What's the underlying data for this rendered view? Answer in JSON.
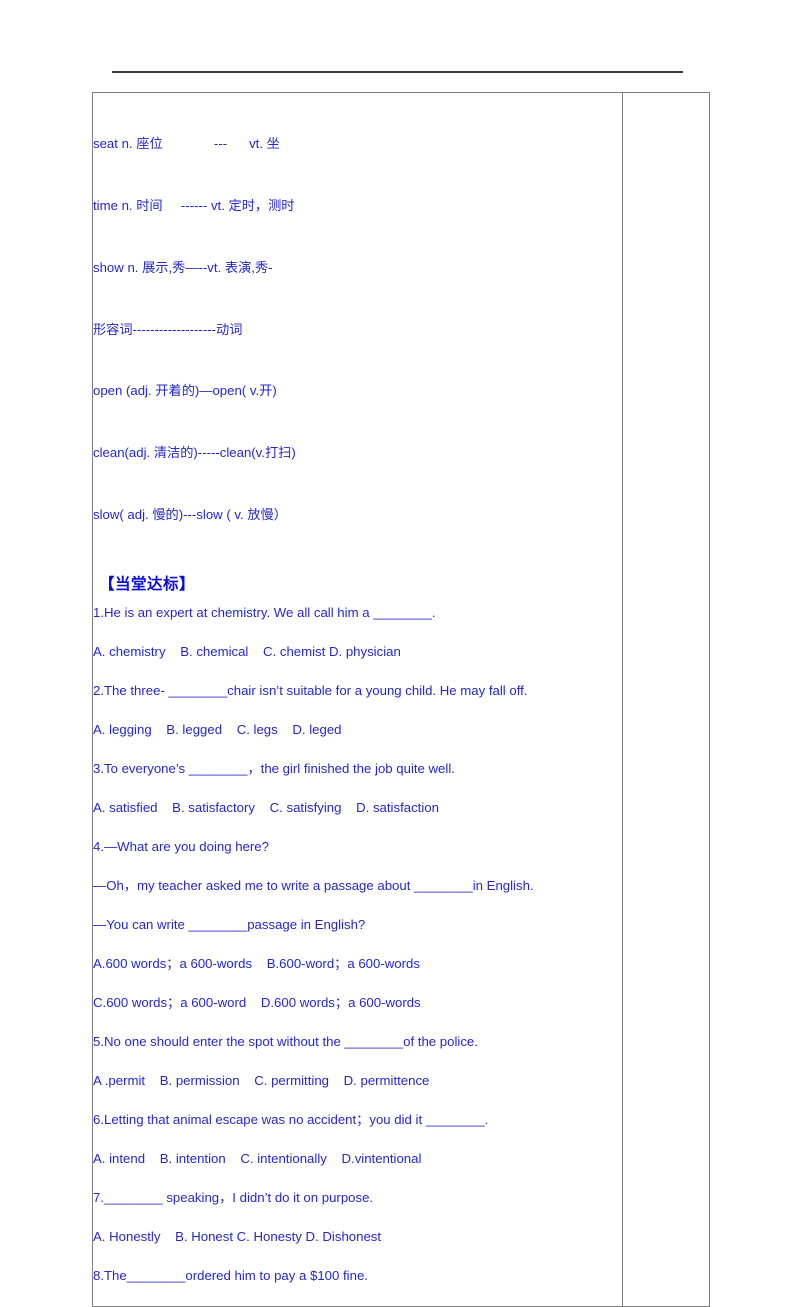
{
  "document": {
    "text_color": "#2727c8",
    "heading_color": "#0b0bd2",
    "border_color": "#808080",
    "rule_color": "#3a3a3a"
  },
  "vocabulary": {
    "lines": [
      "seat n. 座位              ---      vt. 坐",
      "time n. 时间     ------ vt. 定时，测时",
      "show n. 展示,秀—--vt. 表演,秀-",
      "形容词-------------------动词",
      "open (adj. 开着的)—open( v.开)",
      "clean(adj. 清洁的)-----clean(v.打扫)",
      "slow( adj. 慢的)---slow ( v. 放慢）"
    ]
  },
  "section": {
    "heading": "【当堂达标】"
  },
  "exercises": [
    {
      "id": "q1-stem",
      "text": "1.He is an expert at chemistry. We all call him a ________."
    },
    {
      "id": "q1-options",
      "text": "A. chemistry    B. chemical    C. chemist D. physician"
    },
    {
      "id": "q2-stem",
      "text": "2.The three- ________chair isn’t suitable for a young child. He may fall off."
    },
    {
      "id": "q2-options",
      "text": "A. legging    B. legged    C. legs    D. leged"
    },
    {
      "id": "q3-stem",
      "text": "3.To everyone’s ________，the girl finished the job quite well."
    },
    {
      "id": "q3-options",
      "text": "A. satisfied    B. satisfactory    C. satisfying    D. satisfaction"
    },
    {
      "id": "q4-stem",
      "text": "4.—What are you doing here?"
    },
    {
      "id": "q4-line2",
      "text": "—Oh，my teacher asked me to write a passage about ________in English."
    },
    {
      "id": "q4-line3",
      "text": "—You can write ________passage in English?"
    },
    {
      "id": "q4-options1",
      "text": "A.600 words；a 600-words    B.600-word；a 600-words"
    },
    {
      "id": "q4-options2",
      "text": "C.600 words；a 600-word    D.600 words；a 600-words"
    },
    {
      "id": "q5-stem",
      "text": "5.No one should enter the spot without the ________of the police."
    },
    {
      "id": "q5-options",
      "text": "A .permit    B. permission    C. permitting    D. permittence"
    },
    {
      "id": "q6-stem",
      "text": "6.Letting that animal escape was no accident；you did it ________."
    },
    {
      "id": "q6-options",
      "text": "A. intend    B. intention    C. intentionally    D.vintentional"
    },
    {
      "id": "q7-stem",
      "text": "7.________ speaking，I didn’t do it on purpose."
    },
    {
      "id": "q7-options",
      "text": "A. Honestly    B. Honest C. Honesty D. Dishonest"
    },
    {
      "id": "q8-stem",
      "text": "8.The________ordered him to pay a $100 fine."
    }
  ]
}
